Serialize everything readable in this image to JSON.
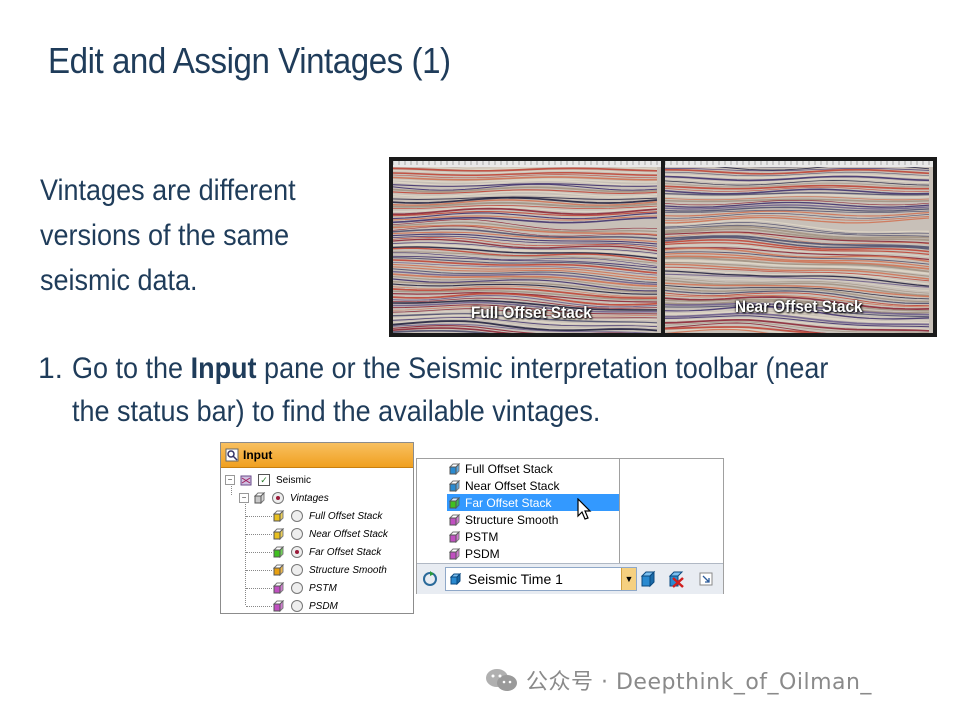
{
  "title": "Edit and Assign Vintages (1)",
  "intro": "Vintages are different versions of the same seismic data.",
  "seismic_labels": {
    "left": "Full Offset Stack",
    "right": "Near Offset Stack"
  },
  "step": {
    "number": "1.",
    "text_before": "Go to the ",
    "bold": "Input",
    "text_after": " pane or the Seismic interpretation toolbar (near the status bar) to find the available vintages."
  },
  "input_pane": {
    "header": "Input",
    "root_label": "Seismic",
    "group_label": "Vintages",
    "items": [
      {
        "label": "Full Offset Stack",
        "color": "#e8c020",
        "selected": false
      },
      {
        "label": "Near Offset Stack",
        "color": "#e8c020",
        "selected": false
      },
      {
        "label": "Far Offset Stack",
        "color": "#40c020",
        "selected": true
      },
      {
        "label": "Structure Smooth",
        "color": "#e8a010",
        "selected": false
      },
      {
        "label": "PSTM",
        "color": "#c050c0",
        "selected": false
      },
      {
        "label": "PSDM",
        "color": "#c050c0",
        "selected": false
      }
    ]
  },
  "dropdown": {
    "items": [
      {
        "label": "Full Offset Stack",
        "color": "#2a8ad0",
        "selected": false
      },
      {
        "label": "Near Offset Stack",
        "color": "#2a8ad0",
        "selected": false
      },
      {
        "label": "Far Offset Stack",
        "color": "#40c020",
        "selected": true
      },
      {
        "label": "Structure Smooth",
        "color": "#c050c0",
        "selected": false
      },
      {
        "label": "PSTM",
        "color": "#c050c0",
        "selected": false
      },
      {
        "label": "PSDM",
        "color": "#c050c0",
        "selected": false
      }
    ],
    "current_value": "Seismic Time 1"
  },
  "watermark": "公众号 · Deepthink_of_Oilman_"
}
